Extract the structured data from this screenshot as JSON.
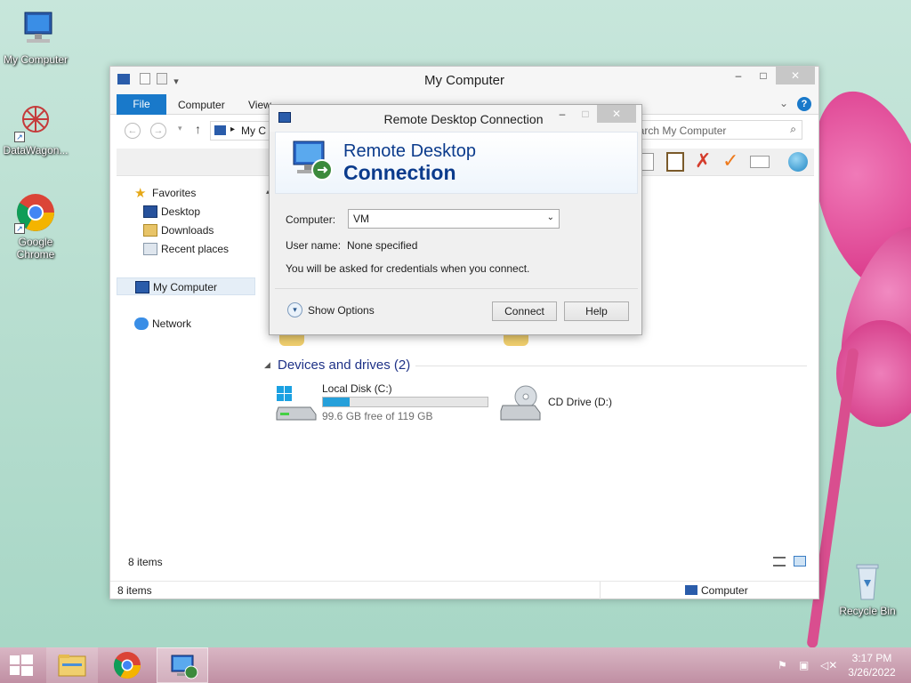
{
  "desktop": {
    "icons": [
      {
        "label": "My Computer",
        "icon": "computer-icon"
      },
      {
        "label": "DataWagon...",
        "icon": "datawagon-icon"
      },
      {
        "label": "Google Chrome",
        "icon": "chrome-icon"
      },
      {
        "label": "Recycle Bin",
        "icon": "recycle-bin-icon"
      }
    ]
  },
  "explorer": {
    "title": "My Computer",
    "tabs": {
      "file": "File",
      "computer": "Computer",
      "view": "View"
    },
    "address_text": "My C",
    "search_placeholder": "Search My Computer",
    "nav": {
      "favorites": "Favorites",
      "desktop": "Desktop",
      "downloads": "Downloads",
      "recent": "Recent places",
      "my_computer": "My Computer",
      "network": "Network"
    },
    "devices_header": "Devices and drives (2)",
    "drives": [
      {
        "name": "Local Disk (C:)",
        "free": "99.6 GB free of 119 GB",
        "used_fraction": 0.163
      },
      {
        "name": "CD Drive (D:)"
      }
    ],
    "item_count_inner": "8 items",
    "status_left": "8 items",
    "status_right": "Computer"
  },
  "rdc": {
    "window_title": "Remote Desktop Connection",
    "banner_line1": "Remote Desktop",
    "banner_line2": "Connection",
    "computer_label": "Computer:",
    "computer_value": "VM",
    "username_label": "User name:",
    "username_value": "None specified",
    "note": "You will be asked for credentials when you connect.",
    "show_options": "Show Options",
    "connect_btn": "Connect",
    "help_btn": "Help"
  },
  "taskbar": {
    "time": "3:17 PM",
    "date": "3/26/2022"
  },
  "colors": {
    "accent": "#1979ca",
    "taskbar": "#c898aa",
    "drive_bar": "#26a0da"
  }
}
